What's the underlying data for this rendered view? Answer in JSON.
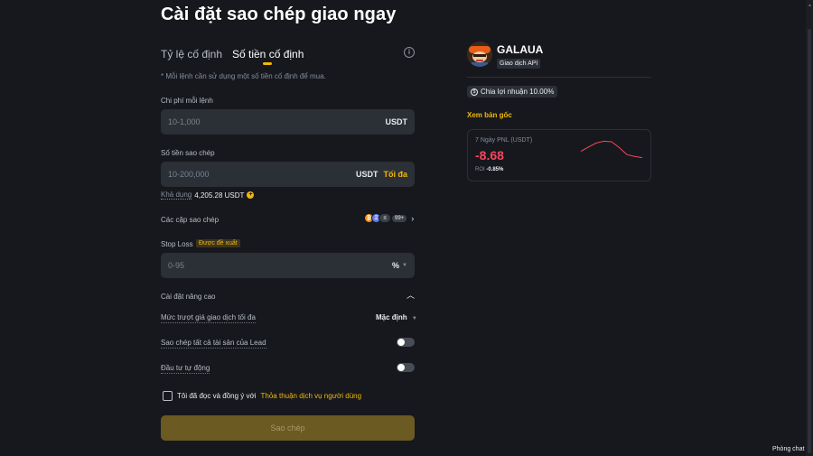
{
  "page": {
    "title": "Cài đặt sao chép giao ngay"
  },
  "tabs": [
    {
      "label": "Tỷ lệ cố định",
      "active": false
    },
    {
      "label": "Số tiền cố định",
      "active": true
    }
  ],
  "info_icon": "info-icon",
  "note": "* Mỗi lệnh cần sử dụng một số tiền cố định để mua.",
  "cost_per_order": {
    "label": "Chi phí mỗi lệnh",
    "placeholder": "10-1,000",
    "unit": "USDT"
  },
  "copy_amount": {
    "label": "Số tiền sao chép",
    "placeholder": "10-200,000",
    "unit": "USDT",
    "max_label": "Tối đa"
  },
  "available": {
    "label": "Khả dụng",
    "value": "4,205.28 USDT",
    "icon": "plus-circle-icon"
  },
  "copy_pairs": {
    "label": "Các cặp sao chép",
    "coins": [
      "₿",
      "Ξ",
      "≡"
    ],
    "count": "99+"
  },
  "stop_loss": {
    "label": "Stop Loss",
    "recommended": "Được đề xuất",
    "placeholder": "0-95",
    "unit": "%"
  },
  "advanced": {
    "label": "Cài đặt nâng cao",
    "slippage_label": "Mức trượt giá giao dịch tối đa",
    "slippage_value": "Mặc định",
    "copy_all_label": "Sao chép tất cả tài sản của Lead",
    "copy_all_on": false,
    "auto_invest_label": "Đầu tư tự động",
    "auto_invest_on": false
  },
  "agreement": {
    "text": "Tôi đã đọc và đồng ý với",
    "link": "Thỏa thuận dịch vụ người dùng",
    "checked": false
  },
  "copy_button": "Sao chép",
  "lead": {
    "name": "GALAUA",
    "badge": "Giao dịch API",
    "profit_share": "Chia lợi nhuận 10.00%",
    "view_original": "Xem bản gốc",
    "pnl_label": "7 Ngày PNL (USDT)",
    "pnl_value": "-8.68",
    "roi_label": "ROI",
    "roi_value": "-0.85%",
    "pnl_trend": [
      0.55,
      0.72,
      0.88,
      0.95,
      0.93,
      0.7,
      0.42,
      0.35,
      0.3
    ],
    "pnl_color": "#f6465d"
  },
  "chat": "Phòng chat",
  "colors": {
    "accent": "#f0b90b",
    "negative": "#f6465d",
    "background": "#17181d",
    "field": "#2b2f36"
  }
}
